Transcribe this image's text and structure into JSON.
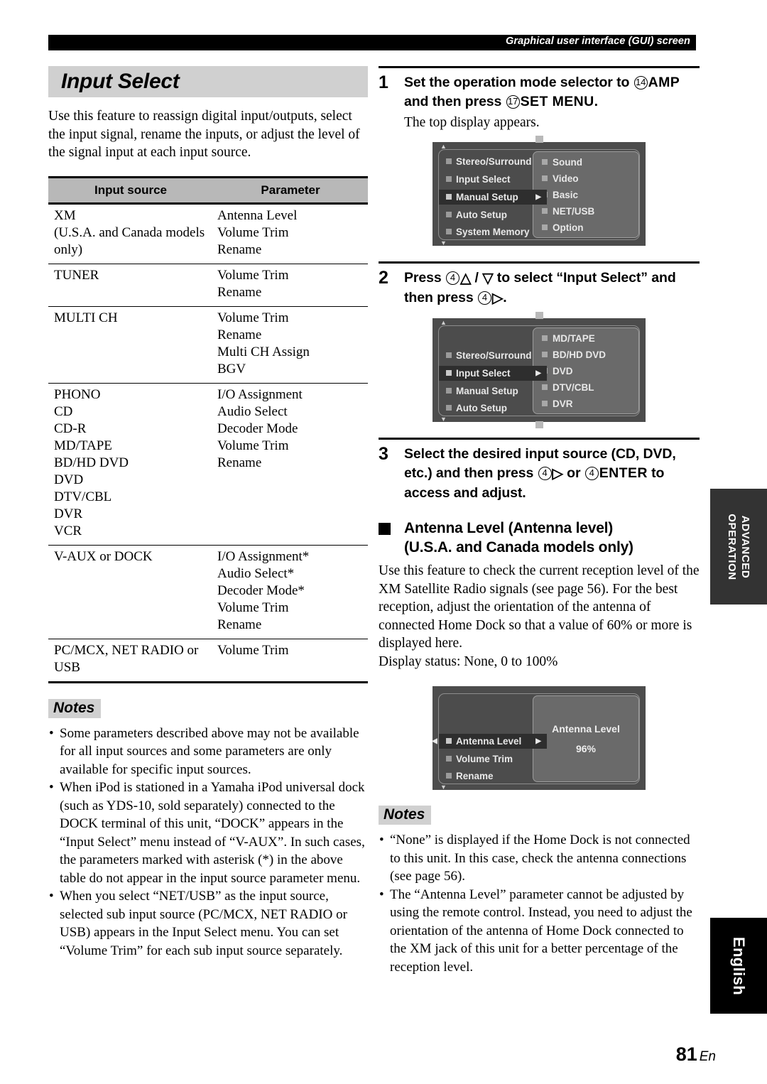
{
  "header": {
    "title": "Graphical user interface (GUI) screen"
  },
  "left": {
    "section_title": "Input Select",
    "intro": "Use this feature to reassign digital input/outputs, select the input signal, rename the inputs, or adjust the level of the signal input at each input source.",
    "table": {
      "headers": [
        "Input source",
        "Parameter"
      ],
      "rows": [
        {
          "source": "XM\n(U.S.A. and Canada models\nonly)",
          "parameter": "Antenna Level\nVolume Trim\nRename"
        },
        {
          "source": "TUNER",
          "parameter": "Volume Trim\nRename"
        },
        {
          "source": "MULTI CH",
          "parameter": "Volume Trim\nRename\nMulti CH Assign\nBGV"
        },
        {
          "source": "PHONO\nCD\nCD-R\nMD/TAPE\nBD/HD DVD\nDVD\nDTV/CBL\nDVR\nVCR",
          "parameter": "I/O Assignment\nAudio Select\nDecoder Mode\nVolume Trim\nRename"
        },
        {
          "source": "V-AUX or DOCK",
          "parameter": "I/O Assignment*\nAudio Select*\nDecoder Mode*\nVolume Trim\nRename"
        },
        {
          "source": "PC/MCX, NET RADIO or\nUSB",
          "parameter": "Volume Trim"
        }
      ]
    },
    "notes_label": "Notes",
    "notes": [
      "Some parameters described above may not be available for all input sources and some parameters are only available for specific input sources.",
      "When iPod is stationed in a Yamaha iPod universal dock (such as YDS-10, sold separately) connected to the DOCK terminal of this unit, “DOCK” appears in the “Input Select” menu instead of “V-AUX”. In such cases, the parameters marked with asterisk (*) in the above table do not appear in the input source parameter menu.",
      "When you select “NET/USB” as the input source, selected sub input source (PC/MCX, NET RADIO or USB) appears in the Input Select menu. You can set “Volume Trim” for each sub input source separately."
    ]
  },
  "right": {
    "step1": {
      "num": "1",
      "head_a": "Set the operation mode selector to ",
      "head_ref1": "14",
      "head_b": "AMP",
      "head_c": " and then press ",
      "head_ref2": "17",
      "head_d": "SET MENU",
      "head_e": ".",
      "sub": "The top display appears."
    },
    "step2": {
      "num": "2",
      "head_a": "Press ",
      "head_ref1": "4",
      "head_up": "△",
      "head_slash": " / ",
      "head_down": "▽",
      "head_b": " to select “Input Select” and then press ",
      "head_ref2": "4",
      "head_right": "▷",
      "head_c": "."
    },
    "step3": {
      "num": "3",
      "head_a": "Select the desired input source (CD, DVD, etc.) and then press ",
      "head_ref1": "4",
      "head_right": "▷",
      "head_b": " or ",
      "head_ref2": "4",
      "head_enter": "ENTER",
      "head_c": " to access and adjust."
    },
    "block_heading_line1": "Antenna Level (Antenna level)",
    "block_heading_line2": "(U.S.A. and Canada models only)",
    "body": "Use this feature to check the current reception level of the XM Satellite Radio signals (see page 56). For the best reception, adjust the orientation of the antenna of connected Home Dock so that a value of 60% or more is displayed here.",
    "status_line": "Display status: None, 0 to 100%",
    "notes_label": "Notes",
    "notes": [
      "“None” is displayed if the Home Dock is not connected to this unit. In this case, check the antenna connections (see page 56).",
      "The “Antenna Level” parameter cannot be adjusted by using the remote control. Instead, you need to adjust the orientation of the antenna of Home Dock connected to the XM jack of this unit for a better percentage of the reception level."
    ]
  },
  "gui1": {
    "left_items": [
      "Stereo/Surround",
      "Input Select",
      "Manual Setup",
      "Auto Setup",
      "System Memory"
    ],
    "selected_index": 2,
    "right_items": [
      "Sound",
      "Video",
      "Basic",
      "NET/USB",
      "Option"
    ]
  },
  "gui2": {
    "left_items": [
      "Stereo/Surround",
      "Input Select",
      "Manual Setup",
      "Auto Setup"
    ],
    "selected_index": 1,
    "right_items": [
      "MD/TAPE",
      "BD/HD DVD",
      "DVD",
      "DTV/CBL",
      "DVR"
    ]
  },
  "gui3": {
    "left_items": [
      "Antenna Level",
      "Volume Trim",
      "Rename"
    ],
    "selected_index": 0,
    "value_title": "Antenna Level",
    "value": "96%"
  },
  "side_tabs": {
    "advanced": "ADVANCED\nOPERATION",
    "english": "English"
  },
  "page": {
    "number": "81",
    "suffix": "En"
  }
}
